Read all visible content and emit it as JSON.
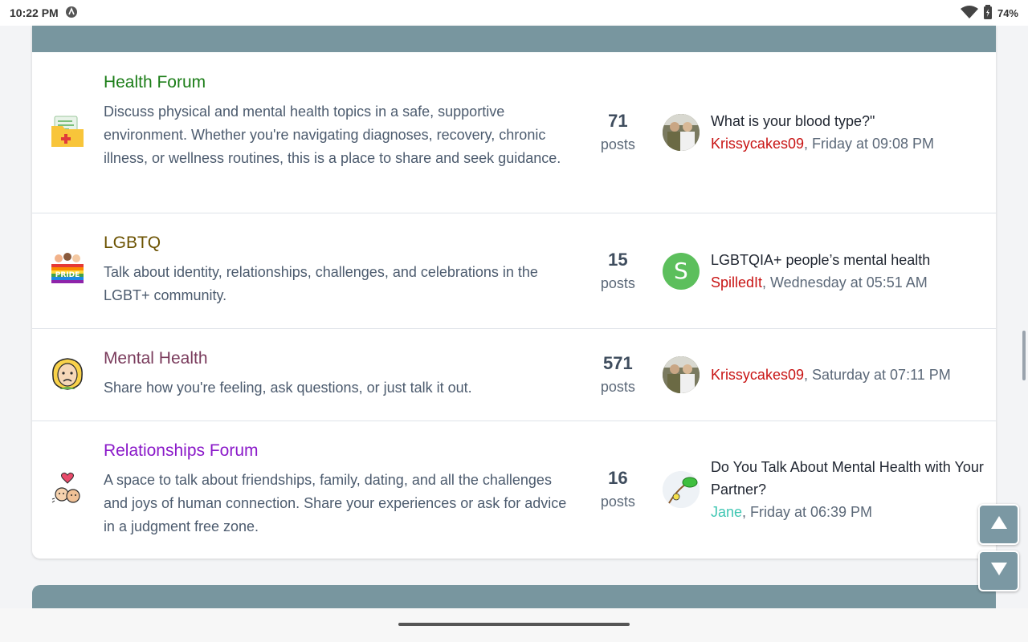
{
  "status_bar": {
    "time": "10:22 PM",
    "battery": "74%"
  },
  "forums": [
    {
      "title": "Health Forum",
      "title_color": "#1b7d17",
      "icon": "medical-folder-icon",
      "description": "Discuss physical and mental health topics in a safe, supportive environment. Whether you're navigating diagnoses, recovery, chronic illness, or wellness routines, this is a place to share and seek guidance.",
      "count": "71",
      "count_label": "posts",
      "last_title": "What is your blood type?\"",
      "last_user": "Krissycakes09",
      "last_time": ", Friday at 09:08 PM",
      "avatar": "photo"
    },
    {
      "title": "LGBTQ",
      "title_color": "#6b5200",
      "icon": "pride-icon",
      "description": "Talk about identity, relationships, challenges, and celebrations in the LGBT+ community.",
      "count": "15",
      "count_label": "posts",
      "last_title": "LGBTQIA+ people’s mental health",
      "last_user": "SpilledIt",
      "last_time": ", Wednesday at 05:51 AM",
      "avatar": "S",
      "avatar_color": "#5cbf5c"
    },
    {
      "title": "Mental Health",
      "title_color": "#7a3b5c",
      "icon": "stressed-face-icon",
      "description": "Share how you're feeling, ask questions, or just talk it out.",
      "count": "571",
      "count_label": "posts",
      "last_title": "",
      "last_user": "Krissycakes09",
      "last_time": ", Saturday at 07:11 PM",
      "avatar": "photo"
    },
    {
      "title": "Relationships Forum",
      "title_color": "#8a19c9",
      "icon": "couple-heart-icon",
      "description": "A space to talk about friendships, family, dating, and all the challenges and joys of human connection. Share your experiences or ask for advice in a judgment free zone.",
      "count": "16",
      "count_label": "posts",
      "last_title": "Do You Talk About Mental Health with Your Partner?",
      "last_user": "Jane",
      "last_time": ", Friday at 06:39 PM",
      "avatar": "parrot"
    }
  ],
  "colors": {
    "header": "#78969f",
    "user_link": "#c81414",
    "user_link_alt": "#3ec6b2"
  }
}
